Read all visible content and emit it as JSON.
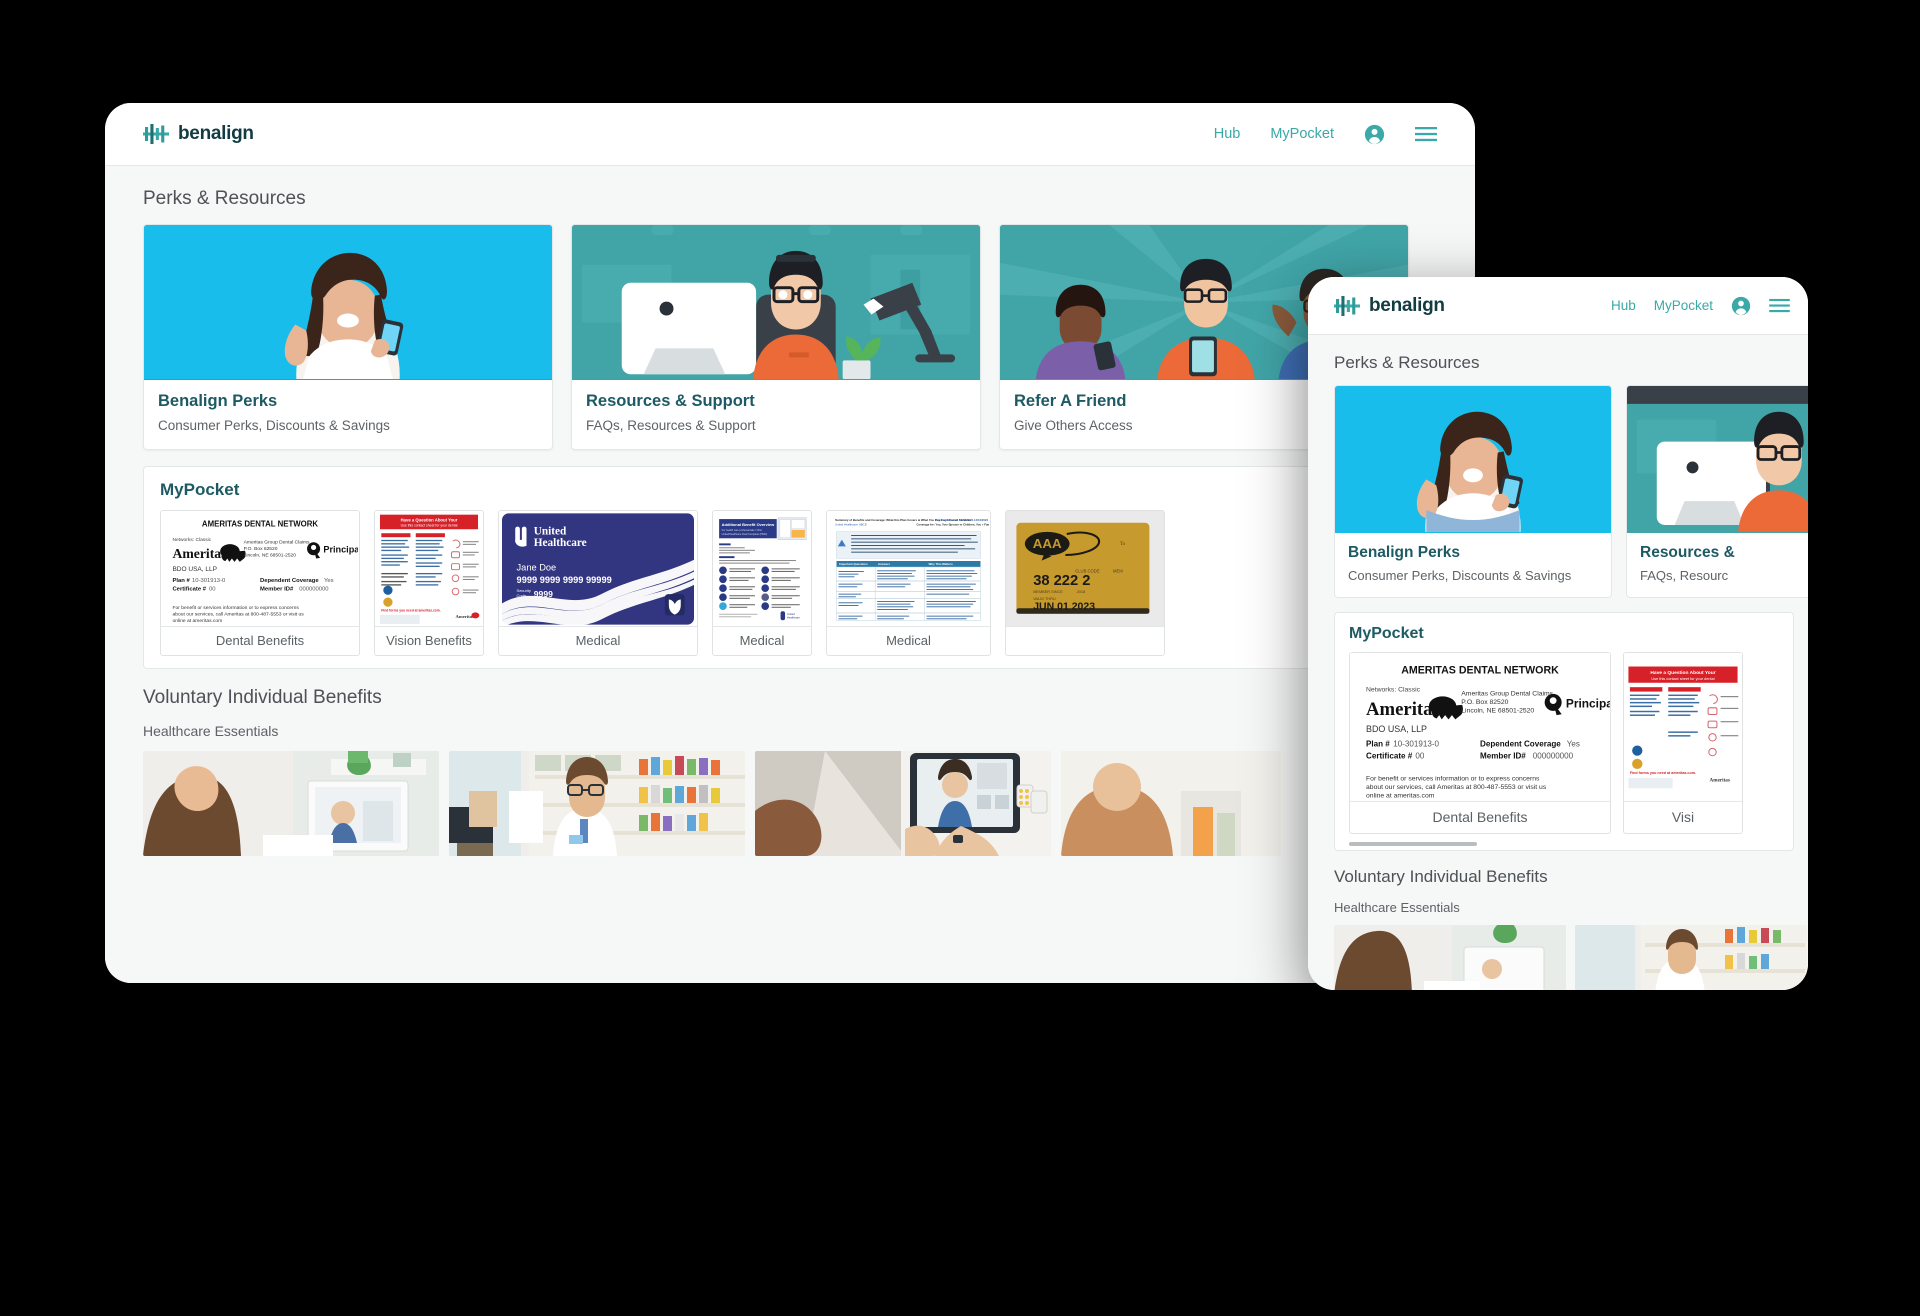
{
  "brand": {
    "name": "benalign",
    "logo_icon": "bar-chart-logo-icon",
    "accent": "#3aa9a8",
    "dark": "#123b42"
  },
  "desktop": {
    "nav": {
      "links": [
        {
          "label": "Hub",
          "name": "hub"
        },
        {
          "label": "MyPocket",
          "name": "mypocket"
        }
      ],
      "account_icon": "account-circle-icon",
      "menu_icon": "hamburger-menu-icon"
    },
    "perks_section": {
      "title": "Perks & Resources",
      "cards": [
        {
          "title": "Benalign Perks",
          "subtitle": "Consumer Perks, Discounts & Savings",
          "image": "woman-with-phone-celebrating",
          "bg": "#18b9e8"
        },
        {
          "title": "Resources & Support",
          "subtitle": "FAQs, Resources & Support",
          "image": "man-at-desk-with-computer",
          "bg": "#3fa3a6"
        },
        {
          "title": "Refer A Friend",
          "subtitle": "Give Others Access",
          "image": "three-people-with-phones",
          "bg": "#3fa3a6"
        }
      ]
    },
    "mypocket_section": {
      "title": "MyPocket",
      "cards": [
        {
          "label": "Dental Benefits",
          "thumb": "ameritas-dental-id-card"
        },
        {
          "label": "Vision Benefits",
          "thumb": "ameritas-contact-sheet-document"
        },
        {
          "label": "Medical",
          "thumb": "united-healthcare-id-card"
        },
        {
          "label": "Medical",
          "thumb": "additional-benefit-overview-document"
        },
        {
          "label": "Medical",
          "thumb": "summary-of-benefits-document"
        },
        {
          "label": "",
          "thumb": "aaa-membership-card"
        }
      ]
    },
    "voluntary_section": {
      "title": "Voluntary Individual Benefits",
      "subtitle": "Healthcare Essentials",
      "images": [
        "telehealth-video-call-laptop",
        "pharmacist-in-pharmacy",
        "telehealth-tablet-nurse-call",
        "woman-partial"
      ]
    }
  },
  "mobile": {
    "nav": {
      "links": [
        {
          "label": "Hub",
          "name": "hub"
        },
        {
          "label": "MyPocket",
          "name": "mypocket"
        }
      ],
      "account_icon": "account-circle-icon",
      "menu_icon": "hamburger-menu-icon"
    },
    "perks_section": {
      "title": "Perks & Resources",
      "cards": [
        {
          "title": "Benalign Perks",
          "subtitle": "Consumer Perks, Discounts & Savings",
          "image": "woman-with-phone-celebrating",
          "bg": "#18b9e8"
        },
        {
          "title": "Resources &",
          "subtitle": "FAQs, Resourc",
          "image": "man-at-desk-with-computer",
          "bg": "#3fa3a6"
        }
      ]
    },
    "mypocket_section": {
      "title": "MyPocket",
      "cards": [
        {
          "label": "Dental Benefits",
          "thumb": "ameritas-dental-id-card"
        },
        {
          "label": "Visi",
          "thumb": "ameritas-contact-sheet-document"
        }
      ]
    },
    "voluntary_section": {
      "title": "Voluntary Individual Benefits",
      "subtitle": "Healthcare Essentials"
    }
  },
  "dental_card": {
    "network_title": "AMERITAS DENTAL NETWORK",
    "networks_line": "Networks: Classic",
    "brand": "Ameritas",
    "claims_address": "Ameritas Group Dental Claims\nP.O. Box 82520\nLincoln, NE 68501-2520",
    "partner": "Principal",
    "employer": "BDO USA, LLP",
    "plan_label": "Plan #",
    "plan_value": "10-301913-0",
    "certificate_label": "Certificate #",
    "certificate_value": "00",
    "dependent_label": "Dependent Coverage",
    "dependent_value": "Yes",
    "member_label": "Member ID#",
    "member_value": "000000000",
    "footer": "For benefit or services information or to express concerns about our services, call Ameritas at 800-487-5553 or visit us online at ameritas.com"
  },
  "uhc_card": {
    "brand_line1": "United",
    "brand_line2": "Healthcare",
    "member_name": "Jane Doe",
    "member_number": "9999 9999 9999 99999",
    "security_label": "Security Code:",
    "security_value": "9999"
  },
  "aaa_card": {
    "brand": "AAA",
    "club_code_label": "CLUB CODE",
    "member_label": "MEMBER",
    "numbers": "38 222 2",
    "member_since_label": "MEMBER SINCE",
    "member_since_value": "2018",
    "valid_thru_label": "VALID THRU",
    "valid_thru_value": "JUN 01 2023"
  },
  "vision_doc": {
    "headline": "Have a Question About Your Ameritas Benefits?",
    "subhead": "Use this contact sheet for your dental, vision and hearing care coverage.",
    "col1": "Benefits Administrator",
    "col2": "Dental",
    "footer_link": "Find forms you need at ameritas.com.",
    "brand": "Ameritas"
  },
  "medical_doc_1": {
    "title": "Additional Benefit Overview",
    "subtitle": "For health care professionals / Ohio",
    "brand": "UnitedHealthcare"
  },
  "medical_doc_2": {
    "title": "Summary of Benefits and Coverage: What this Plan Covers & What You Pay For Covered Services",
    "plan": "United Healthcare: ABCD",
    "coverage_period": "Coverage Period: 01/01/2022-12/31/2022",
    "coverage_for": "Coverage for: You, You+Spouse or Children, You + Family | Plan Type: HSA-P",
    "col_question": "Important Questions",
    "col_answer": "Answers",
    "col_why": "Why This Matters"
  }
}
